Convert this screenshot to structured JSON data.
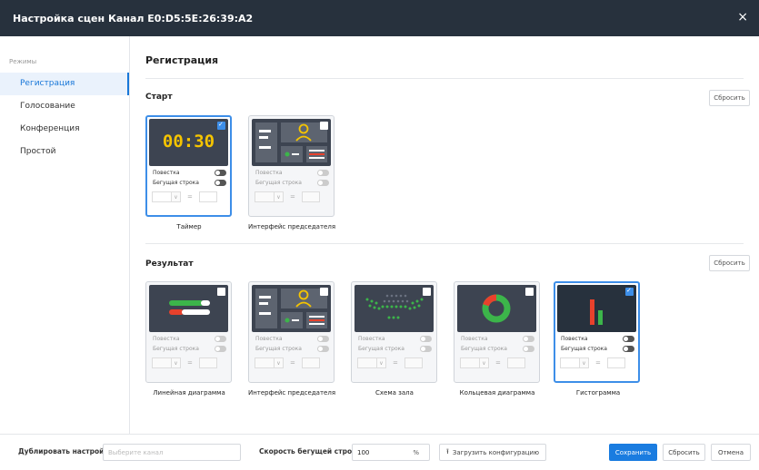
{
  "window": {
    "title": "Настройка сцен Канал E0:D5:5E:26:39:A2",
    "close": "×"
  },
  "sidebar": {
    "header": "Режимы",
    "items": [
      {
        "label": "Регистрация",
        "active": true
      },
      {
        "label": "Голосование",
        "active": false
      },
      {
        "label": "Конференция",
        "active": false
      },
      {
        "label": "Простой",
        "active": false
      }
    ]
  },
  "main": {
    "title": "Регистрация",
    "start": {
      "title": "Старт",
      "reset": "Сбросить",
      "cards": [
        {
          "label": "Таймер",
          "selected": true,
          "timer": "00:30",
          "agenda": "Повестка",
          "ticker": "Бегущая строка",
          "eq": "=",
          "arrow": "∨"
        },
        {
          "label": "Интерфейс председателя",
          "selected": false,
          "agenda": "Повестка",
          "ticker": "Бегущая строка",
          "eq": "=",
          "arrow": "∨"
        }
      ]
    },
    "result": {
      "title": "Результат",
      "reset": "Сбросить",
      "cards": [
        {
          "label": "Линейная диаграмма",
          "selected": false,
          "agenda": "Повестка",
          "ticker": "Бегущая строка",
          "eq": "=",
          "arrow": "∨"
        },
        {
          "label": "Интерфейс председателя",
          "selected": false,
          "agenda": "Повестка",
          "ticker": "Бегущая строка",
          "eq": "=",
          "arrow": "∨"
        },
        {
          "label": "Схема зала",
          "selected": false,
          "agenda": "Повестка",
          "ticker": "Бегущая строка",
          "eq": "=",
          "arrow": "∨"
        },
        {
          "label": "Кольцевая диаграмма",
          "selected": false,
          "agenda": "Повестка",
          "ticker": "Бегущая строка",
          "eq": "=",
          "arrow": "∨"
        },
        {
          "label": "Гистограмма",
          "selected": true,
          "agenda": "Повестка",
          "ticker": "Бегущая строка",
          "eq": "=",
          "arrow": "∨"
        }
      ]
    }
  },
  "footer": {
    "duplicate_label": "Дублировать настройки:",
    "duplicate_placeholder": "Выберите канал",
    "speed_label": "Скорость бегущей строки:",
    "speed_value": "100",
    "speed_unit": "%",
    "upload_label": "Загрузить конфигурацию",
    "save": "Сохранить",
    "reset": "Сбросить",
    "cancel": "Отмена"
  },
  "colors": {
    "accent": "#1a7ce0",
    "titlebar": "#27313d",
    "thumb": "#3d4451",
    "timer": "#f5c400",
    "green": "#3cb54a",
    "red": "#e8412c"
  }
}
